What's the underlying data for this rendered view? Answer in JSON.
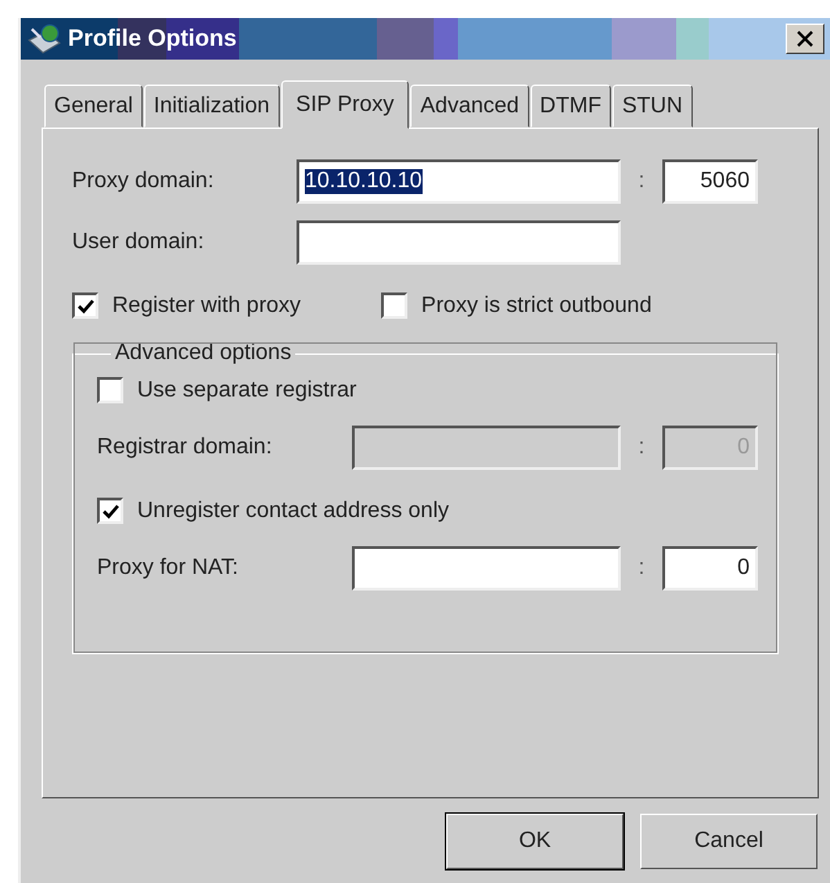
{
  "window": {
    "title": "Profile Options"
  },
  "tabs": [
    {
      "label": "General",
      "selected": false
    },
    {
      "label": "Initialization",
      "selected": false
    },
    {
      "label": "SIP Proxy",
      "selected": true
    },
    {
      "label": "Advanced",
      "selected": false
    },
    {
      "label": "DTMF",
      "selected": false
    },
    {
      "label": "STUN",
      "selected": false
    }
  ],
  "fields": [
    {
      "label": "Proxy domain:",
      "value": "10.10.10.10",
      "highlighted": true,
      "separator": ":",
      "port": "5060"
    },
    {
      "label": "User domain:"
    }
  ],
  "checkboxes": [
    {
      "label": "Register with proxy",
      "checked": true
    },
    {
      "label": "Proxy is strict outbound",
      "checked": false
    }
  ],
  "advanced_options": {
    "legend": "Advanced options",
    "items": [
      {
        "kind": "checkbox",
        "label": "Use separate registrar",
        "checked": false
      },
      {
        "kind": "field",
        "label": "Registrar domain:",
        "separator": ":",
        "port": "0",
        "disabled": true
      },
      {
        "kind": "checkbox",
        "label": "Unregister contact address only",
        "checked": true
      },
      {
        "kind": "field",
        "label": "Proxy for NAT:",
        "separator": ":",
        "port": "0",
        "disabled": false
      }
    ]
  },
  "buttons": [
    {
      "label": "OK",
      "default": true
    },
    {
      "label": "Cancel",
      "default": false
    }
  ]
}
